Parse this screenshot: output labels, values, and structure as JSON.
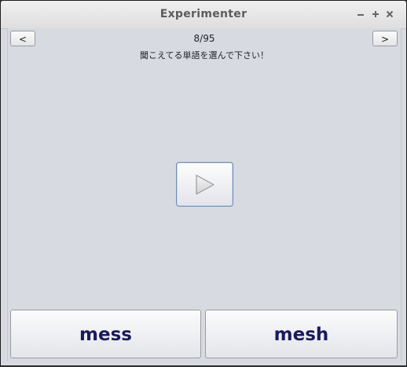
{
  "window": {
    "title": "Experimenter",
    "controls": [
      "minimize-icon",
      "maximize-icon",
      "close-icon"
    ]
  },
  "nav": {
    "prev_label": "<",
    "next_label": ">",
    "counter": "8/95"
  },
  "instruction": "聞こえてる単語を選んで下さい！",
  "play": {
    "icon": "play-icon"
  },
  "choices": [
    {
      "label": "mess"
    },
    {
      "label": "mesh"
    }
  ],
  "colors": {
    "background": "#d8dae2",
    "choice_text": "#1a1a5c",
    "play_border": "#6d8eb3"
  }
}
